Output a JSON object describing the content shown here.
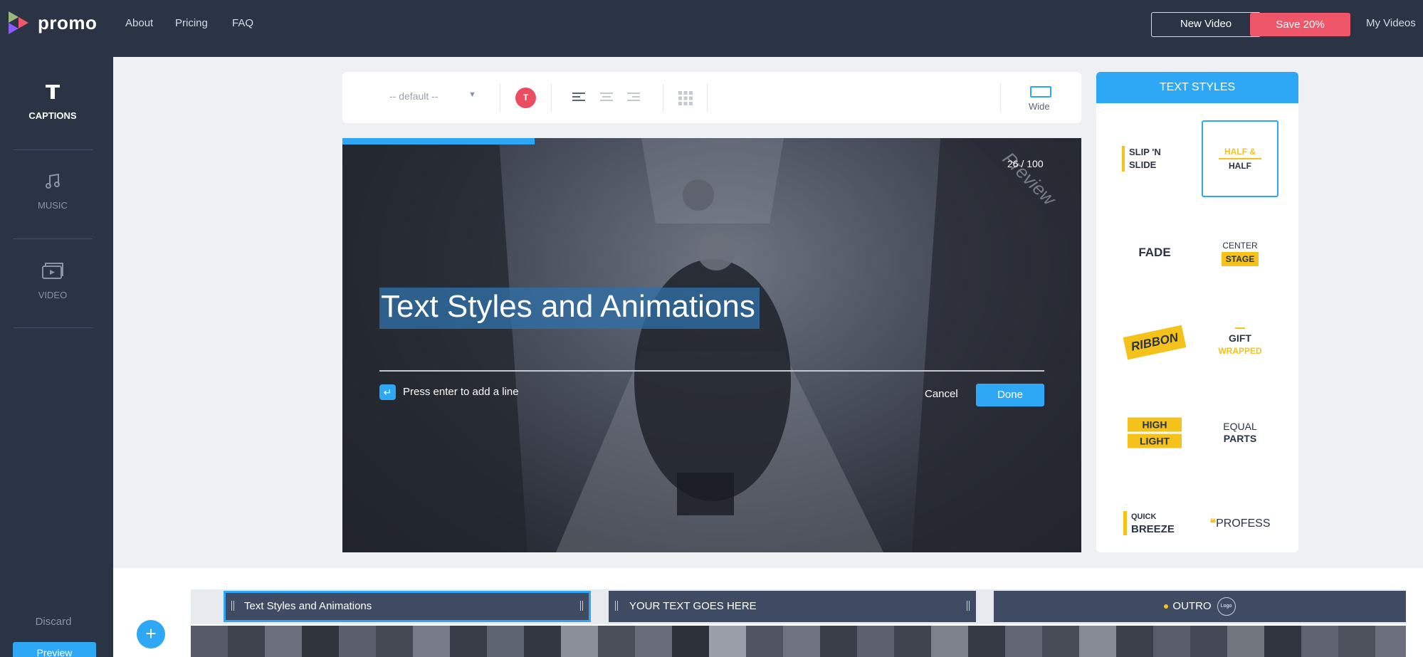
{
  "app": {
    "logo_text": "promo",
    "nav": [
      "About",
      "Pricing",
      "FAQ"
    ],
    "new_video_label": "New Video",
    "save_label": "Save 20%",
    "my_videos_label": "My Videos",
    "colors": {
      "dark": "#2b3445",
      "accent": "#2ea8f5",
      "save": "#f0566a",
      "highlight": "#f5c21b"
    }
  },
  "sidebar": {
    "items": [
      {
        "label": "CAPTIONS",
        "icon": "text-icon",
        "active": true
      },
      {
        "label": "MUSIC",
        "icon": "music-note-icon",
        "active": false
      },
      {
        "label": "VIDEO",
        "icon": "video-clips-icon",
        "active": false
      }
    ],
    "discard_label": "Discard",
    "bottom_button_label": "Preview"
  },
  "toolbar": {
    "font_value": "-- default --",
    "color_letter": "T",
    "wide_label": "Wide"
  },
  "preview": {
    "char_count": "26 / 100",
    "watermark": "Preview",
    "caption_text": "Text Styles and Animations",
    "enter_hint": "Press enter to add a line",
    "cancel_label": "Cancel",
    "done_label": "Done",
    "progress": 0.26
  },
  "text_styles": {
    "header": "TEXT STYLES",
    "slip": [
      "SLIP 'N",
      "SLIDE"
    ],
    "half": [
      "HALF &",
      "HALF"
    ],
    "fade": "FADE",
    "center": [
      "CENTER",
      "STAGE"
    ],
    "ribbon": "RIBBON",
    "gift": [
      "GIFT",
      "WRAPPED"
    ],
    "highlight": [
      "HIGH",
      "LIGHT"
    ],
    "equal": [
      "EQUAL",
      "PARTS"
    ],
    "quick": [
      "QUICK",
      "BREEZE"
    ],
    "profess": "PROFESS"
  },
  "timeline": {
    "add_label": "+",
    "clips": [
      "Text Styles and Animations",
      "YOUR TEXT GOES HERE",
      "OUTRO"
    ],
    "outro_logo_text": "Logo"
  }
}
